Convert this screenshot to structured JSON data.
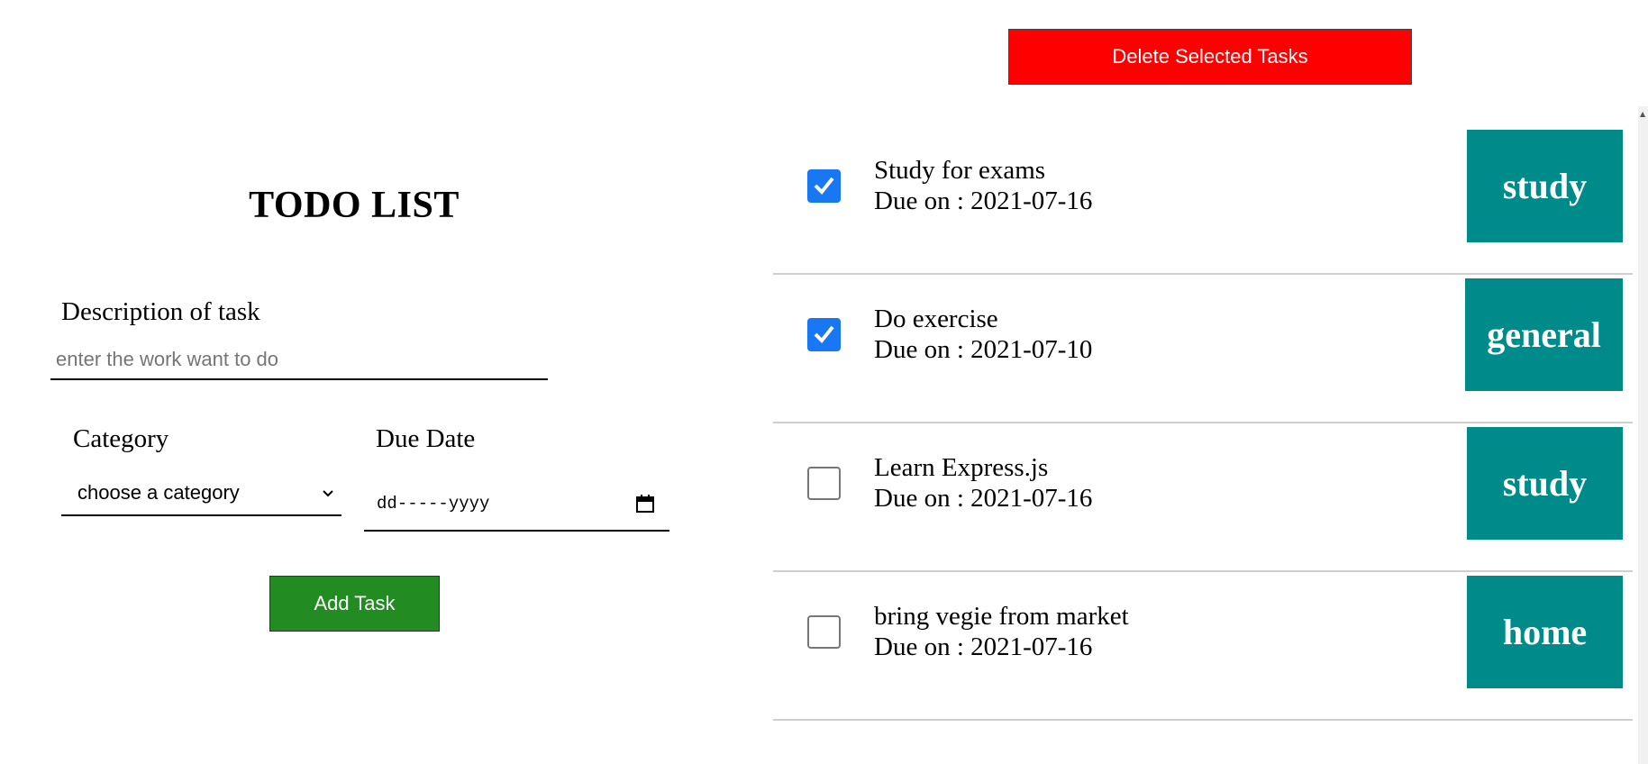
{
  "form": {
    "title": "TODO LIST",
    "description_label": "Description of task",
    "description_placeholder": "enter the work want to do",
    "category_label": "Category",
    "category_selected": "choose a category",
    "due_date_label": "Due Date",
    "due_date_placeholder": "dd-----yyyy",
    "add_button": "Add Task"
  },
  "toolbar": {
    "delete_button": "Delete Selected Tasks"
  },
  "colors": {
    "add_button": "#228b22",
    "delete_button": "#ff0000",
    "category_badge": "#008b8b",
    "checkbox_checked": "#1877f2"
  },
  "tasks": [
    {
      "description": "Study for exams",
      "due": "Due on : 2021-07-16",
      "category": "study",
      "checked": true
    },
    {
      "description": "Do exercise",
      "due": "Due on : 2021-07-10",
      "category": "general",
      "checked": true
    },
    {
      "description": "Learn Express.js",
      "due": "Due on : 2021-07-16",
      "category": "study",
      "checked": false
    },
    {
      "description": "bring vegie from market",
      "due": "Due on : 2021-07-16",
      "category": "home",
      "checked": false
    }
  ]
}
